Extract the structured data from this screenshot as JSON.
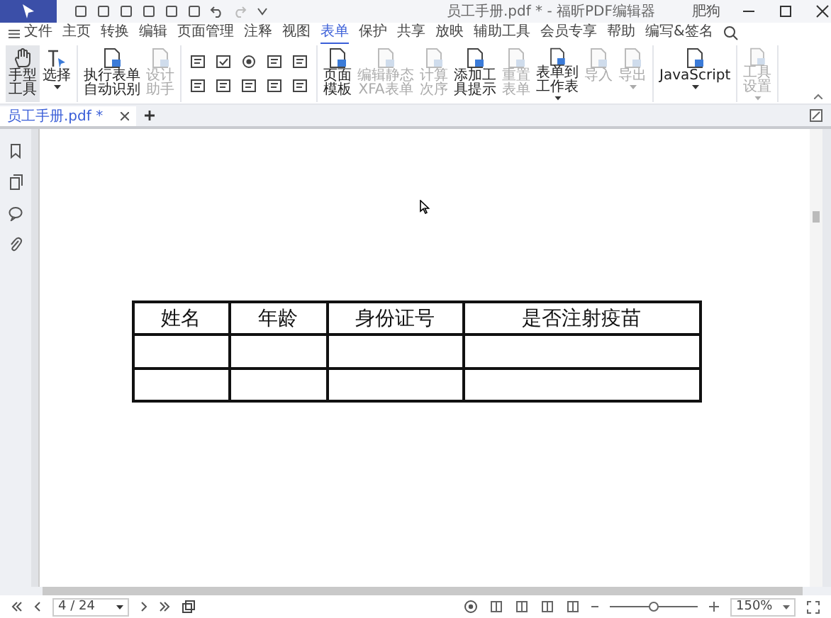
{
  "title_bar": {
    "title": "员工手册.pdf * - 福昕PDF编辑器",
    "user": "肥狗"
  },
  "menu": [
    {
      "label": "文件",
      "selected": false
    },
    {
      "label": "主页",
      "selected": false
    },
    {
      "label": "转换",
      "selected": false
    },
    {
      "label": "编辑",
      "selected": false
    },
    {
      "label": "页面管理",
      "selected": false
    },
    {
      "label": "注释",
      "selected": false
    },
    {
      "label": "视图",
      "selected": false
    },
    {
      "label": "表单",
      "selected": true
    },
    {
      "label": "保护",
      "selected": false
    },
    {
      "label": "共享",
      "selected": false
    },
    {
      "label": "放映",
      "selected": false
    },
    {
      "label": "辅助工具",
      "selected": false
    },
    {
      "label": "会员专享",
      "selected": false
    },
    {
      "label": "帮助",
      "selected": false
    },
    {
      "label": "编写&签名",
      "selected": false
    }
  ],
  "ribbon": [
    {
      "kind": "buttons",
      "items": [
        {
          "lines": [
            "手型",
            "工具"
          ],
          "selected": true,
          "disabled": false,
          "dropdown": false
        },
        {
          "lines": [
            "选择"
          ],
          "selected": false,
          "disabled": false,
          "dropdown": true
        }
      ]
    },
    {
      "kind": "buttons",
      "items": [
        {
          "lines": [
            "执行表单",
            "自动识别"
          ],
          "selected": false,
          "disabled": false,
          "dropdown": false
        },
        {
          "lines": [
            "设计",
            "助手"
          ],
          "selected": false,
          "disabled": true,
          "dropdown": false
        }
      ]
    },
    {
      "kind": "fields"
    },
    {
      "kind": "buttons",
      "items": [
        {
          "lines": [
            "页面",
            "模板"
          ],
          "selected": false,
          "disabled": false,
          "dropdown": false
        },
        {
          "lines": [
            "编辑静态",
            "XFA表单"
          ],
          "selected": false,
          "disabled": true,
          "dropdown": false
        },
        {
          "lines": [
            "计算",
            "次序"
          ],
          "selected": false,
          "disabled": true,
          "dropdown": false
        },
        {
          "lines": [
            "添加工",
            "具提示"
          ],
          "selected": false,
          "disabled": false,
          "dropdown": false
        },
        {
          "lines": [
            "重置",
            "表单"
          ],
          "selected": false,
          "disabled": true,
          "dropdown": false
        },
        {
          "lines": [
            "表单到",
            "工作表"
          ],
          "selected": false,
          "disabled": false,
          "dropdown": true
        },
        {
          "lines": [
            "导入"
          ],
          "selected": false,
          "disabled": true,
          "dropdown": false
        },
        {
          "lines": [
            "导出"
          ],
          "selected": false,
          "disabled": true,
          "dropdown": true
        }
      ]
    },
    {
      "kind": "buttons",
      "items": [
        {
          "lines": [
            "JavaScript"
          ],
          "selected": false,
          "disabled": false,
          "dropdown": true
        }
      ]
    },
    {
      "kind": "buttons",
      "items": [
        {
          "lines": [
            "工具",
            "设置"
          ],
          "selected": false,
          "disabled": true,
          "dropdown": true
        }
      ]
    }
  ],
  "doc_tabs": [
    {
      "label": "员工手册.pdf *",
      "selected": true
    }
  ],
  "table": {
    "columns": [
      "姓名",
      "年龄",
      "身份证号",
      "是否注射疫苗"
    ]
  },
  "status_bar": {
    "page": "4 / 24",
    "zoom": "150%",
    "zoom_slider": {
      "level": 0.5
    }
  }
}
